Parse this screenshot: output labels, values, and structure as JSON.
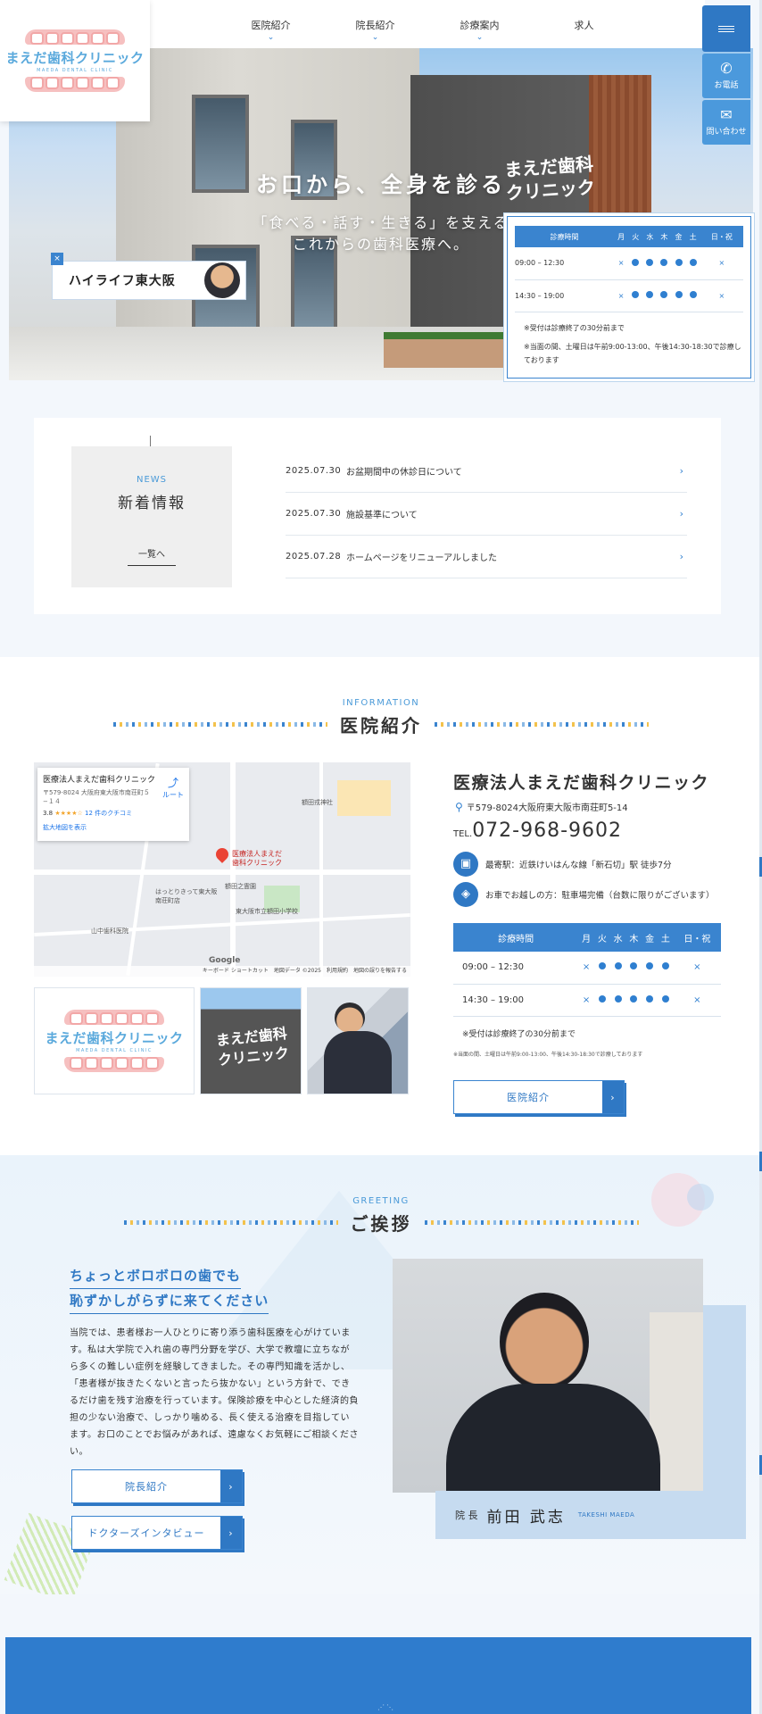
{
  "brand": {
    "name": "まえだ歯科クリニック",
    "sub": "MAEDA DENTAL CLINIC",
    "accent": "#2f78c4",
    "light_accent": "#4a9ad8",
    "pink": "#f6c0c0"
  },
  "nav": {
    "items": [
      {
        "label": "医院紹介",
        "has_dropdown": true
      },
      {
        "label": "院長紹介",
        "has_dropdown": true
      },
      {
        "label": "診療案内",
        "has_dropdown": true
      },
      {
        "label": "求人",
        "has_dropdown": false
      }
    ],
    "side": {
      "tel_label": "お電話",
      "contact_label": "問い合わせ"
    }
  },
  "hero": {
    "title": "お口から、全身を診る",
    "sub1": "「食べる・話す・生きる」を支える",
    "sub2": "これからの歯科医療へ。",
    "sign": "まえだ歯科\nクリニック",
    "banner": "ハイライフ東大阪",
    "banner_close": "×"
  },
  "schedule": {
    "header": [
      "診療時間",
      "月",
      "火",
      "水",
      "木",
      "金",
      "土",
      "日・祝"
    ],
    "rows": [
      {
        "time": "09:00 – 12:30",
        "marks": [
          "×",
          "●",
          "●",
          "●",
          "●",
          "●",
          "×"
        ]
      },
      {
        "time": "14:30 – 19:00",
        "marks": [
          "×",
          "●",
          "●",
          "●",
          "●",
          "●",
          "×"
        ]
      }
    ],
    "note1": "※受付は診療終了の30分前まで",
    "note2": "※当面の間、土曜日は午前9:00-13:00、午後14:30-18:30で診療しております"
  },
  "news": {
    "en": "NEWS",
    "title": "新着情報",
    "more": "一覧へ",
    "items": [
      {
        "date": "2025.07.30",
        "title": "お盆期間中の休診日について"
      },
      {
        "date": "2025.07.30",
        "title": "施設基準について"
      },
      {
        "date": "2025.07.28",
        "title": "ホームページをリニューアルしました"
      }
    ]
  },
  "info": {
    "en": "INFORMATION",
    "title": "医院紹介",
    "clinic_name": "医療法人まえだ歯科クリニック",
    "address": "〒579-8024大阪府東大阪市南荘町5-14",
    "tel_label": "TEL.",
    "tel": "072-968-9602",
    "train": "最寄駅：近鉄けいはんな線「新石切」駅 徒歩7分",
    "car": "お車でお越しの方：駐車場完備（台数に限りがございます）",
    "note_small": "※当面の間、土曜日は午前9:00-13:00、午後14:30-18:30で診療しております",
    "button": "医院紹介",
    "thumb_sign": "まえだ歯科\nクリニック",
    "map": {
      "card_title": "医療法人まえだ歯科クリニック",
      "card_address": "〒579-8024 大阪府東大阪市南荘町５−１４",
      "rating": "3.8",
      "stars": "★★★★☆",
      "reviews": "12 件のクチコミ",
      "enlarge": "拡大地図を表示",
      "route": "ルート",
      "pin_label": "医療法人まえだ\n歯科クリニック",
      "labels": [
        "額田戎神社",
        "東大阪市立額田小学校",
        "山中歯科医院",
        "額田之霊園",
        "はっとりきって東大阪南荘町店"
      ],
      "footer": "キーボード ショートカット　地図データ ©2025　利用規約　地図の誤りを報告する",
      "google": "Google"
    }
  },
  "greeting": {
    "en": "GREETING",
    "title": "ご挨拶",
    "head1": "ちょっとボロボロの歯でも",
    "head2": "恥ずかしがらずに来てください",
    "body": "当院では、患者様お一人ひとりに寄り添う歯科医療を心がけています。私は大学院で入れ歯の専門分野を学び、大学で教壇に立ちながら多くの難しい症例を経験してきました。その専門知識を活かし、「患者様が抜きたくないと言ったら抜かない」という方針で、できるだけ歯を残す治療を行っています。保険診療を中心とした経済的負担の少ない治療で、しっかり噛める、長く使える治療を目指しています。お口のことでお悩みがあれば、遠慮なくお気軽にご相談ください。",
    "btn1": "院長紹介",
    "btn2": "ドクターズインタビュー",
    "role": "院 長",
    "name": "前田 武志",
    "name_en": "TAKESHI MAEDA"
  }
}
